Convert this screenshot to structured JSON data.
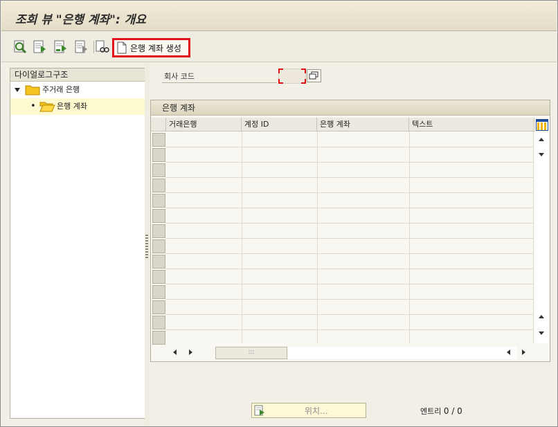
{
  "window": {
    "title": "조회 뷰 \"은행 계좌\": 개요"
  },
  "toolbar": {
    "buttons": [
      {
        "name": "check-icon"
      },
      {
        "name": "previous-entry-icon"
      },
      {
        "name": "next-entry-icon"
      },
      {
        "name": "select-all-icon"
      },
      {
        "name": "where-used-icon"
      }
    ],
    "create_label": "은행 계좌 생성"
  },
  "dialog_structure": {
    "header": "다이얼로그구조",
    "items": [
      {
        "label": "주거래 은행",
        "level": 0,
        "expanded": true
      },
      {
        "label": "은행 계좌",
        "level": 1,
        "selected": true
      }
    ]
  },
  "company_code": {
    "label": "회사 코드",
    "value": ""
  },
  "grid": {
    "title": "은행 계좌",
    "columns": [
      "거래은행",
      "계정 ID",
      "은행 계좌",
      "텍스트"
    ],
    "rows": []
  },
  "footer": {
    "position_label": "위치...",
    "entries_label": "엔트리",
    "entries_value": "0 / 0"
  },
  "colors": {
    "highlight": "#e0101c",
    "selection": "#fdfacf",
    "folder": "#f5c320"
  }
}
